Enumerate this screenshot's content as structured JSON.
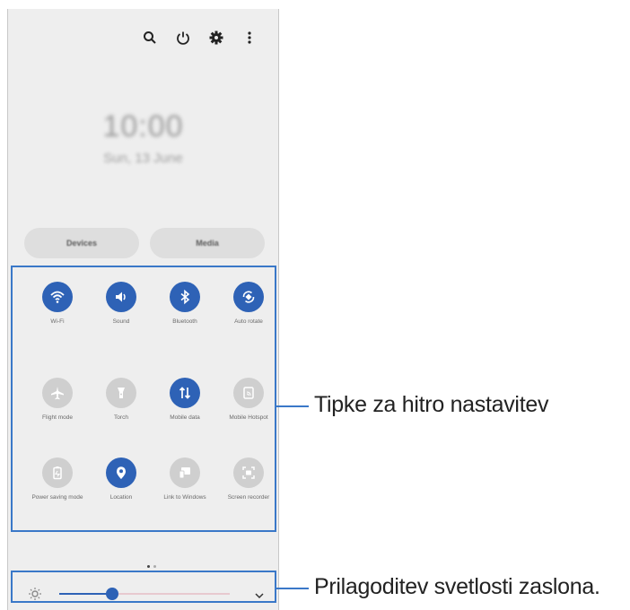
{
  "status_bar": {
    "icons": [
      "search-icon",
      "power-icon",
      "gear-icon",
      "more-vertical-icon"
    ]
  },
  "lock_info": {
    "time": "10:00",
    "date": "Sun, 13 June"
  },
  "pills": {
    "devices": "Devices",
    "media": "Media"
  },
  "quick_settings": [
    {
      "label": "Wi-Fi",
      "icon": "wifi-icon",
      "active": true
    },
    {
      "label": "Sound",
      "icon": "sound-icon",
      "active": true
    },
    {
      "label": "Bluetooth",
      "icon": "bluetooth-icon",
      "active": true
    },
    {
      "label": "Auto rotate",
      "icon": "auto-rotate-icon",
      "active": true
    },
    {
      "label": "Flight mode",
      "icon": "airplane-icon",
      "active": false
    },
    {
      "label": "Torch",
      "icon": "torch-icon",
      "active": false
    },
    {
      "label": "Mobile data",
      "icon": "mobile-data-icon",
      "active": true
    },
    {
      "label": "Mobile Hotspot",
      "icon": "hotspot-icon",
      "active": false
    },
    {
      "label": "Power saving mode",
      "icon": "power-saving-icon",
      "active": false
    },
    {
      "label": "Location",
      "icon": "location-icon",
      "active": true
    },
    {
      "label": "Link to Windows",
      "icon": "link-windows-icon",
      "active": false
    },
    {
      "label": "Screen recorder",
      "icon": "screen-recorder-icon",
      "active": false
    }
  ],
  "page_indicator": {
    "pages": 2,
    "current": 1
  },
  "brightness": {
    "level": 0.31,
    "icon": "sun-icon",
    "expand_icon": "chevron-down-icon"
  },
  "callouts": {
    "quick_settings": "Tipke za hitro nastavitev",
    "brightness": "Prilagoditev svetlosti zaslona."
  },
  "colors": {
    "accent": "#2e62b6",
    "inactive": "#cfcfcf",
    "panel_bg": "#eeeeee",
    "callout_border": "#3a78c8"
  }
}
